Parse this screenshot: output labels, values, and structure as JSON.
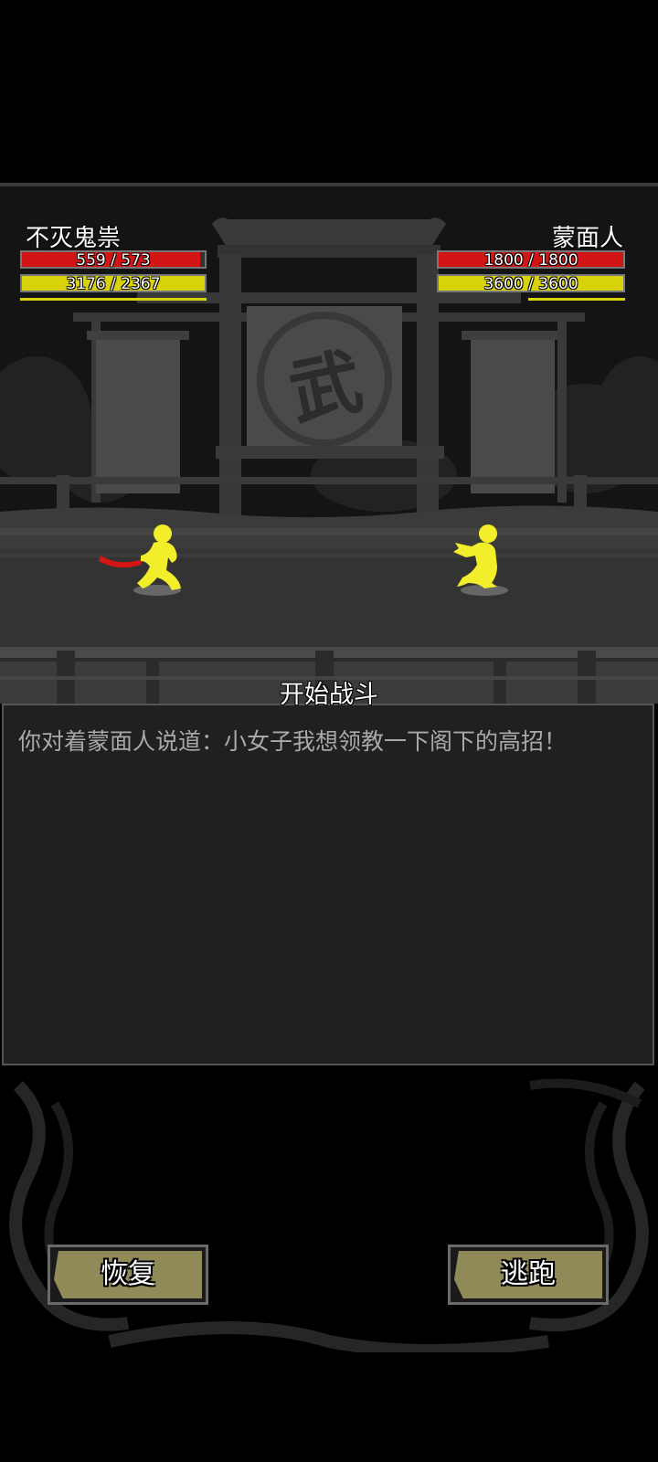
{
  "player": {
    "name": "不灭鬼祟",
    "hp_text": "559 / 573",
    "hp_fraction": 0.976,
    "mp_text": "3176 / 2367",
    "mp_fraction": 1.0
  },
  "enemy": {
    "name": "蒙面人",
    "hp_text": "1800 / 1800",
    "hp_fraction": 1.0,
    "mp_text": "3600 / 3600",
    "mp_fraction": 1.0
  },
  "scene": {
    "banner_glyph": "武"
  },
  "log": {
    "title": "开始战斗",
    "lines": [
      "你对着蒙面人说道：小女子我想领教一下阁下的高招！"
    ]
  },
  "actions": {
    "recover_label": "恢复",
    "flee_label": "逃跑"
  },
  "colors": {
    "hp": "#d31515",
    "mp": "#d8d20a",
    "fighter": "#f2ee2a",
    "weapon": "#d31515",
    "button": "#8f8a58"
  }
}
